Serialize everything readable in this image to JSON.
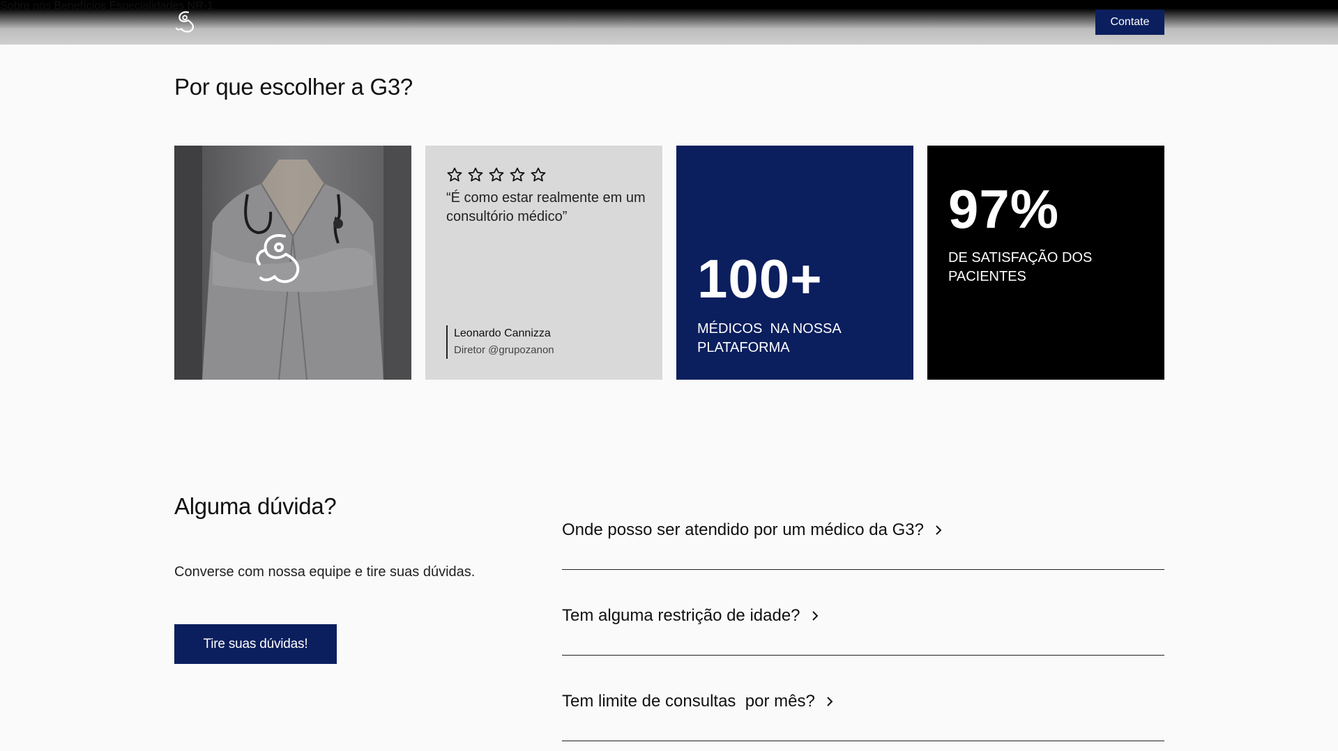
{
  "header": {
    "nav": [
      "Sobre nós",
      "Benefícios",
      "Especialidades",
      "NR-1"
    ],
    "contact_label": "Contate"
  },
  "why": {
    "title": "Por que escolher a G3?",
    "rating_stars": 5,
    "quote": "“É como estar realmente em um consultório médico”",
    "author_name": "Leonardo Cannizza",
    "author_role": "Diretor @grupozanon",
    "stat1_value": "100+",
    "stat1_label_line1": "MÉDICOS  NA NOSSA",
    "stat1_label_line2": "PLATAFORMA",
    "stat2_value": "97%",
    "stat2_label_line1": "DE SATISFAÇÃO DOS",
    "stat2_label_line2": "PACIENTES"
  },
  "faq": {
    "title": "Alguma dúvida?",
    "description": "Converse com nossa equipe e tire suas dúvidas.",
    "button_label": "Tire suas dúvidas!",
    "questions": [
      "Onde posso ser atendido por um médico da G3?",
      "Tem alguma restrição de idade?",
      "Tem limite de consultas  por mês?"
    ]
  },
  "colors": {
    "brand_navy": "#0b1f5e",
    "black": "#000000",
    "quote_bg": "#d9d9d9"
  }
}
